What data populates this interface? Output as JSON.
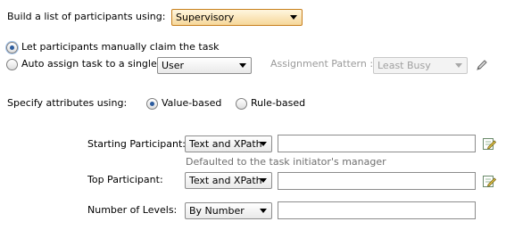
{
  "participants": {
    "label": "Build a list of participants using:",
    "value": "Supervisory"
  },
  "claim": {
    "manual_label": "Let participants manually claim the task",
    "auto_label": "Auto assign task to a single",
    "auto_target": "User",
    "pattern_label": "Assignment Pattern :",
    "pattern_value": "Least Busy"
  },
  "attributes": {
    "label": "Specify attributes using:",
    "value_based": "Value-based",
    "rule_based": "Rule-based"
  },
  "starting": {
    "label": "Starting Participant:",
    "type": "Text and XPath",
    "value": "",
    "hint": "Defaulted to the task initiator's manager"
  },
  "top": {
    "label": "Top Participant:",
    "type": "Text and XPath",
    "value": ""
  },
  "levels": {
    "label": "Number of Levels:",
    "type": "By Number",
    "value": ""
  },
  "colors": {
    "selected_dropdown_bg": "#f6d79a",
    "radio_dot": "#2c5c9e"
  },
  "icons": [
    "edit-pencil-icon",
    "edit-note-icon"
  ]
}
